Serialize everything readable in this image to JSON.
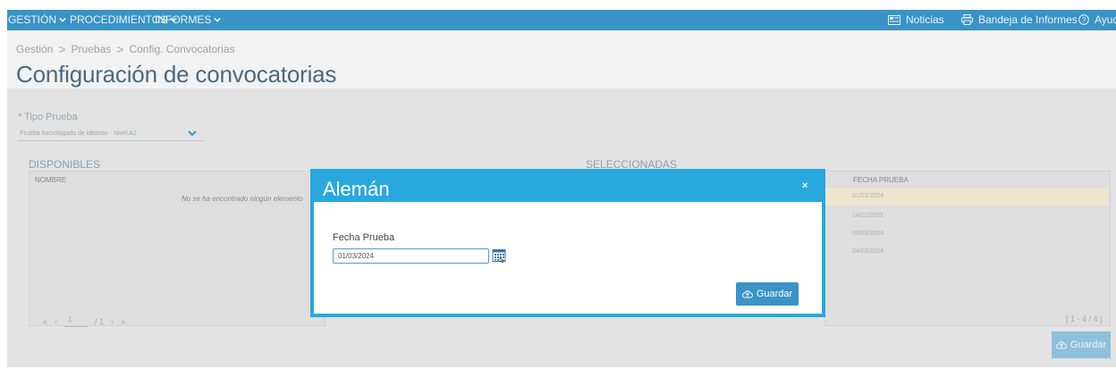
{
  "nav": {
    "menus": [
      {
        "label": "GESTIÓN"
      },
      {
        "label": "PROCEDIMIENTOS"
      },
      {
        "label": "INFORMES"
      }
    ],
    "right": {
      "noticias": "Noticias",
      "bandeja": "Bandeja de Informes",
      "ayuda": "Ayud"
    }
  },
  "breadcrumb": [
    "Gestión",
    "Pruebas",
    "Config. Convocatorias"
  ],
  "page_title": "Configuración de convocatorias",
  "form": {
    "tipo_label": "* Tipo Prueba",
    "tipo_value": "Prueba homologada de idiomas - Nivel A2"
  },
  "disponibles": {
    "title": "DISPONIBLES",
    "col_nombre": "NOMBRE",
    "empty_msg": "No se ha encontrado ningún elemento"
  },
  "seleccionadas": {
    "title": "SELECCIONADAS",
    "col_fecha": "FECHA PRUEBA",
    "dates": [
      "01/03/2024",
      "14/11/2023",
      "09/03/2024",
      "24/03/2024"
    ],
    "range": "[ 1 - 4 / 4 ]"
  },
  "pager": {
    "page": "1",
    "total": "/ 1"
  },
  "guardar_label": "Guardar",
  "modal": {
    "title": "Alemán",
    "close": "×",
    "field_label": "Fecha Prueba",
    "field_value": "01/03/2024",
    "save_label": "Guardar"
  },
  "colors": {
    "nav": "#3a93c6",
    "modal_border": "#29a8dd",
    "button": "#3a93c6"
  }
}
